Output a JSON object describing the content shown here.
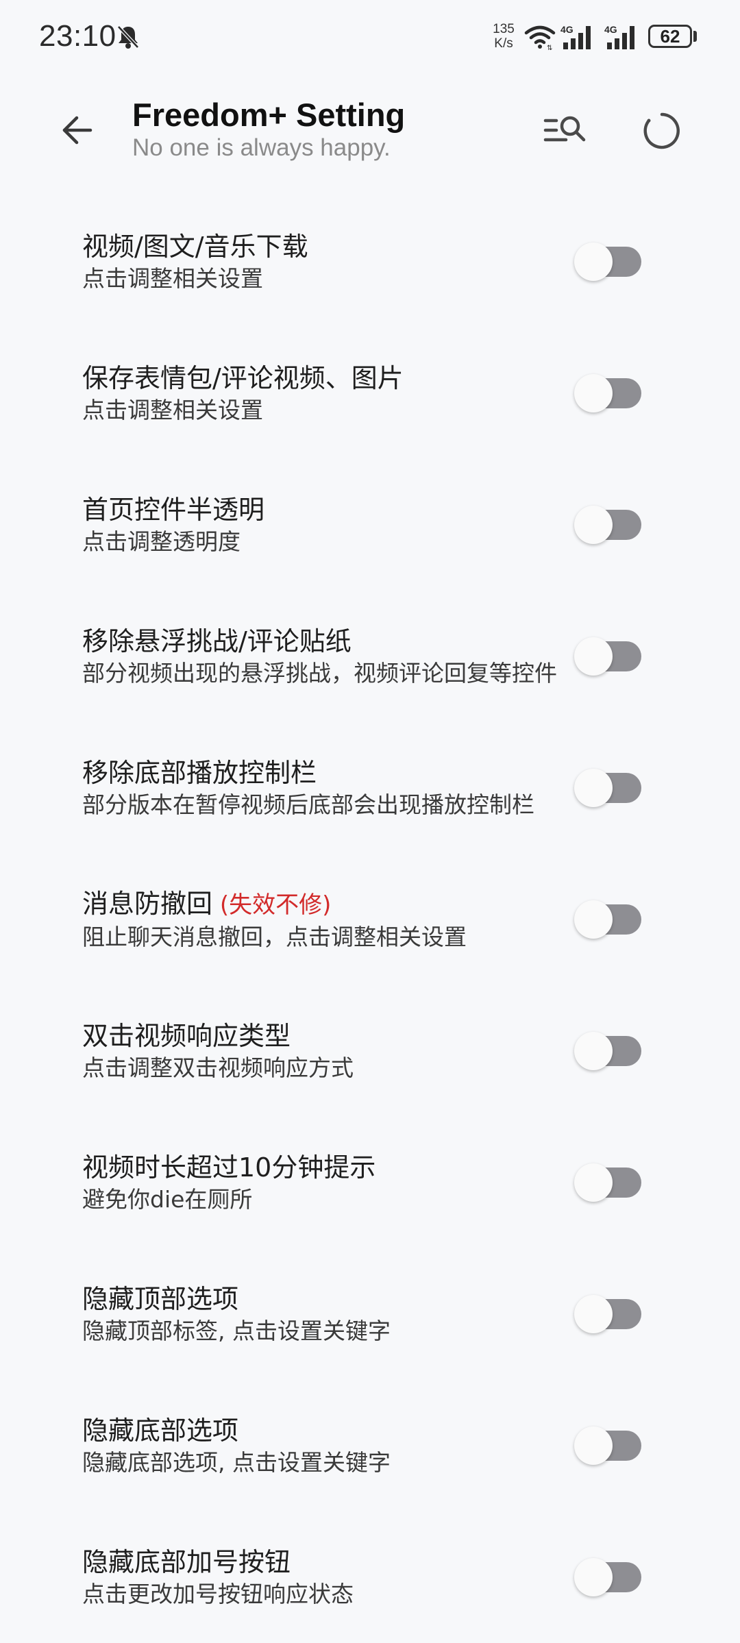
{
  "status_bar": {
    "time": "23:10",
    "net_speed_value": "135",
    "net_speed_unit": "K/s",
    "battery": "62",
    "bell_icon": "bell-off-icon",
    "wifi_icon": "wifi-icon",
    "signal_icon": "signal-4g-icon",
    "signal_label": "4G"
  },
  "header": {
    "back_icon": "back-arrow-icon",
    "title": "Freedom+ Setting",
    "subtitle": "No one is always happy.",
    "search_icon": "list-search-icon",
    "refresh_icon": "refresh-icon"
  },
  "colors": {
    "background": "#f7f8fa",
    "toggle_off_track": "#8e8e93",
    "toggle_knob": "#fafafa",
    "warning_text": "#d22a2a",
    "subtitle_text": "#8a8a8a"
  },
  "settings": [
    {
      "title": "视频/图文/音乐下载",
      "note": "",
      "desc": "点击调整相关设置",
      "enabled": false
    },
    {
      "title": "保存表情包/评论视频、图片",
      "note": "",
      "desc": "点击调整相关设置",
      "enabled": false
    },
    {
      "title": "首页控件半透明",
      "note": "",
      "desc": "点击调整透明度",
      "enabled": false
    },
    {
      "title": "移除悬浮挑战/评论贴纸",
      "note": "",
      "desc": "部分视频出现的悬浮挑战，视频评论回复等控件",
      "enabled": false
    },
    {
      "title": "移除底部播放控制栏",
      "note": "",
      "desc": "部分版本在暂停视频后底部会出现播放控制栏",
      "enabled": false
    },
    {
      "title": "消息防撤回",
      "note": "(失效不修)",
      "desc": "阻止聊天消息撤回，点击调整相关设置",
      "enabled": false
    },
    {
      "title": "双击视频响应类型",
      "note": "",
      "desc": "点击调整双击视频响应方式",
      "enabled": false
    },
    {
      "title": "视频时长超过10分钟提示",
      "note": "",
      "desc": "避免你die在厕所",
      "enabled": false
    },
    {
      "title": "隐藏顶部选项",
      "note": "",
      "desc": "隐藏顶部标签, 点击设置关键字",
      "enabled": false
    },
    {
      "title": "隐藏底部选项",
      "note": "",
      "desc": "隐藏底部选项, 点击设置关键字",
      "enabled": false
    },
    {
      "title": "隐藏底部加号按钮",
      "note": "",
      "desc": "点击更改加号按钮响应状态",
      "enabled": false
    }
  ]
}
